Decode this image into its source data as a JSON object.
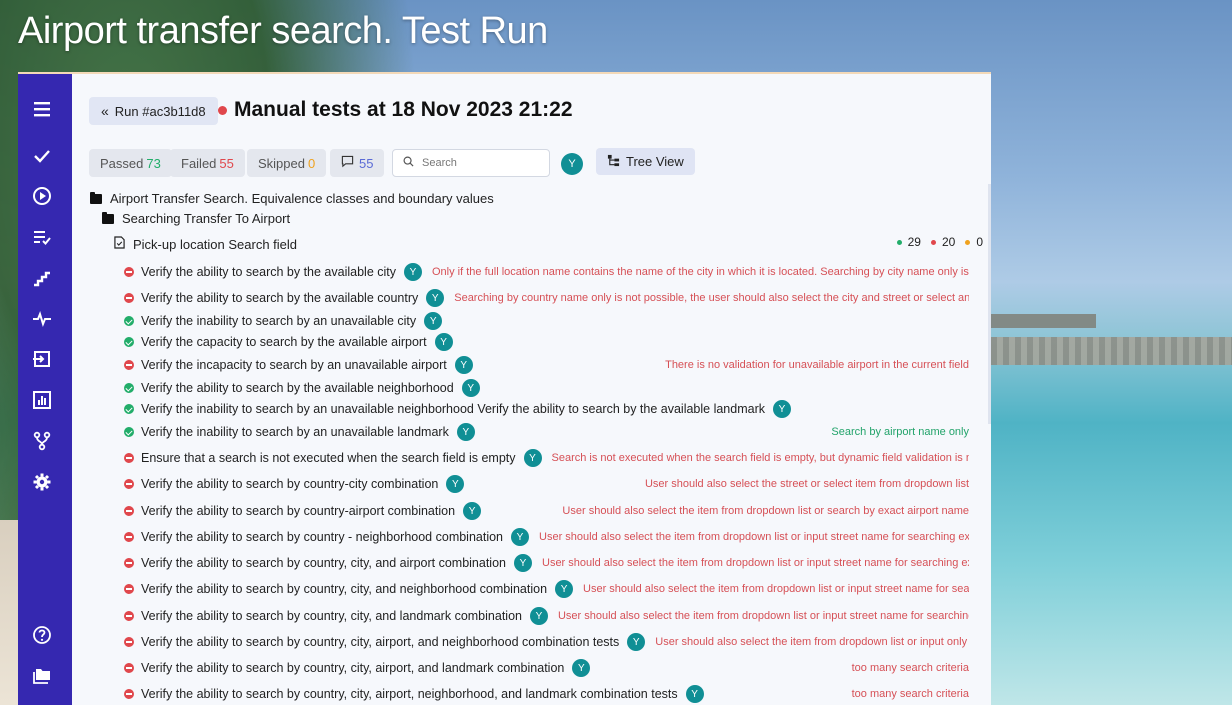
{
  "slide_title": "Airport transfer search. Test Run",
  "header": {
    "run_label": "Run #ac3b11d8",
    "title": "Manual tests at 18 Nov 2023 21:22"
  },
  "filters": {
    "passed_label": "Passed",
    "passed_count": "73",
    "failed_label": "Failed",
    "failed_count": "55",
    "skipped_label": "Skipped",
    "skipped_count": "0",
    "comments_count": "55",
    "search_placeholder": "Search",
    "avatar_letter": "Y",
    "tree_view_label": "Tree View"
  },
  "tree": {
    "root_folder": "Airport Transfer Search. Equivalence classes and boundary values",
    "sub_folder": "Searching Transfer To Airport",
    "suite": "Pick-up location Search field",
    "stats": {
      "passed": "29",
      "failed": "20",
      "skipped": "0"
    }
  },
  "tests": [
    {
      "status": "failed",
      "title": "Verify the ability to search by the available city",
      "note": "Only if the full location name contains the name of the city in which it is located. Searching by city name only is not po",
      "note_color": "red"
    },
    {
      "status": "failed",
      "title": "Verify the ability to search by the available country",
      "note": "Searching by country name only is not possible, the user should also select the city and street or select an item fro",
      "note_color": "red"
    },
    {
      "status": "passed",
      "title": "Verify the inability to search by an unavailable city",
      "note": "",
      "note_color": ""
    },
    {
      "status": "passed",
      "title": "Verify the capacity to search by the available airport",
      "note": "",
      "note_color": ""
    },
    {
      "status": "failed",
      "title": "Verify the incapacity to search by an unavailable airport",
      "note": "There is no validation for unavailable airport in the current field",
      "note_color": "red"
    },
    {
      "status": "passed",
      "title": "Verify the ability to search by the available neighborhood",
      "note": "",
      "note_color": ""
    },
    {
      "status": "passed",
      "title": "Verify the inability to search by an unavailable neighborhood Verify the ability to search by the available landmark",
      "note": "",
      "note_color": ""
    },
    {
      "status": "passed",
      "title": "Verify the inability to search by an unavailable landmark",
      "note": "Search by airport name only",
      "note_color": "green"
    },
    {
      "status": "failed",
      "title": "Ensure that a search is not executed when the search field is empty",
      "note": "Search is not executed when the search field is empty, but dynamic field validation is not availa",
      "note_color": "red"
    },
    {
      "status": "failed",
      "title": "Verify the ability to search by country-city combination",
      "note": "User should also select the street or select item from dropdown list",
      "note_color": "red"
    },
    {
      "status": "failed",
      "title": "Verify the ability to search by country-airport combination",
      "note": "User should also select the item from dropdown list or search by exact airport name",
      "note_color": "red"
    },
    {
      "status": "failed",
      "title": "Verify the ability to search by country - neighborhood combination",
      "note": "User should also select the item from dropdown list or input street name for searching exact loc",
      "note_color": "red"
    },
    {
      "status": "failed",
      "title": "Verify the ability to search by country, city, and airport combination",
      "note": "User should also select the item from dropdown list or input street name for searching exact lo",
      "note_color": "red"
    },
    {
      "status": "failed",
      "title": "Verify the ability to search by country, city, and neighborhood combination",
      "note": "User should also select the item from dropdown list or input street name for searching",
      "note_color": "red"
    },
    {
      "status": "failed",
      "title": "Verify the ability to search by country, city, and landmark combination",
      "note": "User should also select the item from dropdown list or input street name for searching exact",
      "note_color": "red"
    },
    {
      "status": "failed",
      "title": "Verify the ability to search by country, city, airport, and neighborhood combination tests",
      "note": "User should also select the item from dropdown list or input only city a",
      "note_color": "red"
    },
    {
      "status": "failed",
      "title": "Verify the ability to search by country, city, airport, and landmark combination",
      "note": "too many search criteria",
      "note_color": "red"
    },
    {
      "status": "failed",
      "title": "Verify the ability to search by country, city, airport, neighborhood, and landmark combination tests",
      "note": "too many search criteria",
      "note_color": "red"
    }
  ],
  "sidebar_icons": [
    "menu-icon",
    "check-icon",
    "play-circle-icon",
    "list-check-icon",
    "steps-icon",
    "pulse-icon",
    "import-icon",
    "analytics-icon",
    "branch-icon",
    "gear-icon",
    "help-icon",
    "folders-icon"
  ],
  "colors": {
    "sidebar": "#3528b0",
    "failed": "#e0474c",
    "passed": "#22ad6a",
    "skipped": "#f0a21e",
    "avatar": "#108f95",
    "comments": "#5a6ad6"
  }
}
